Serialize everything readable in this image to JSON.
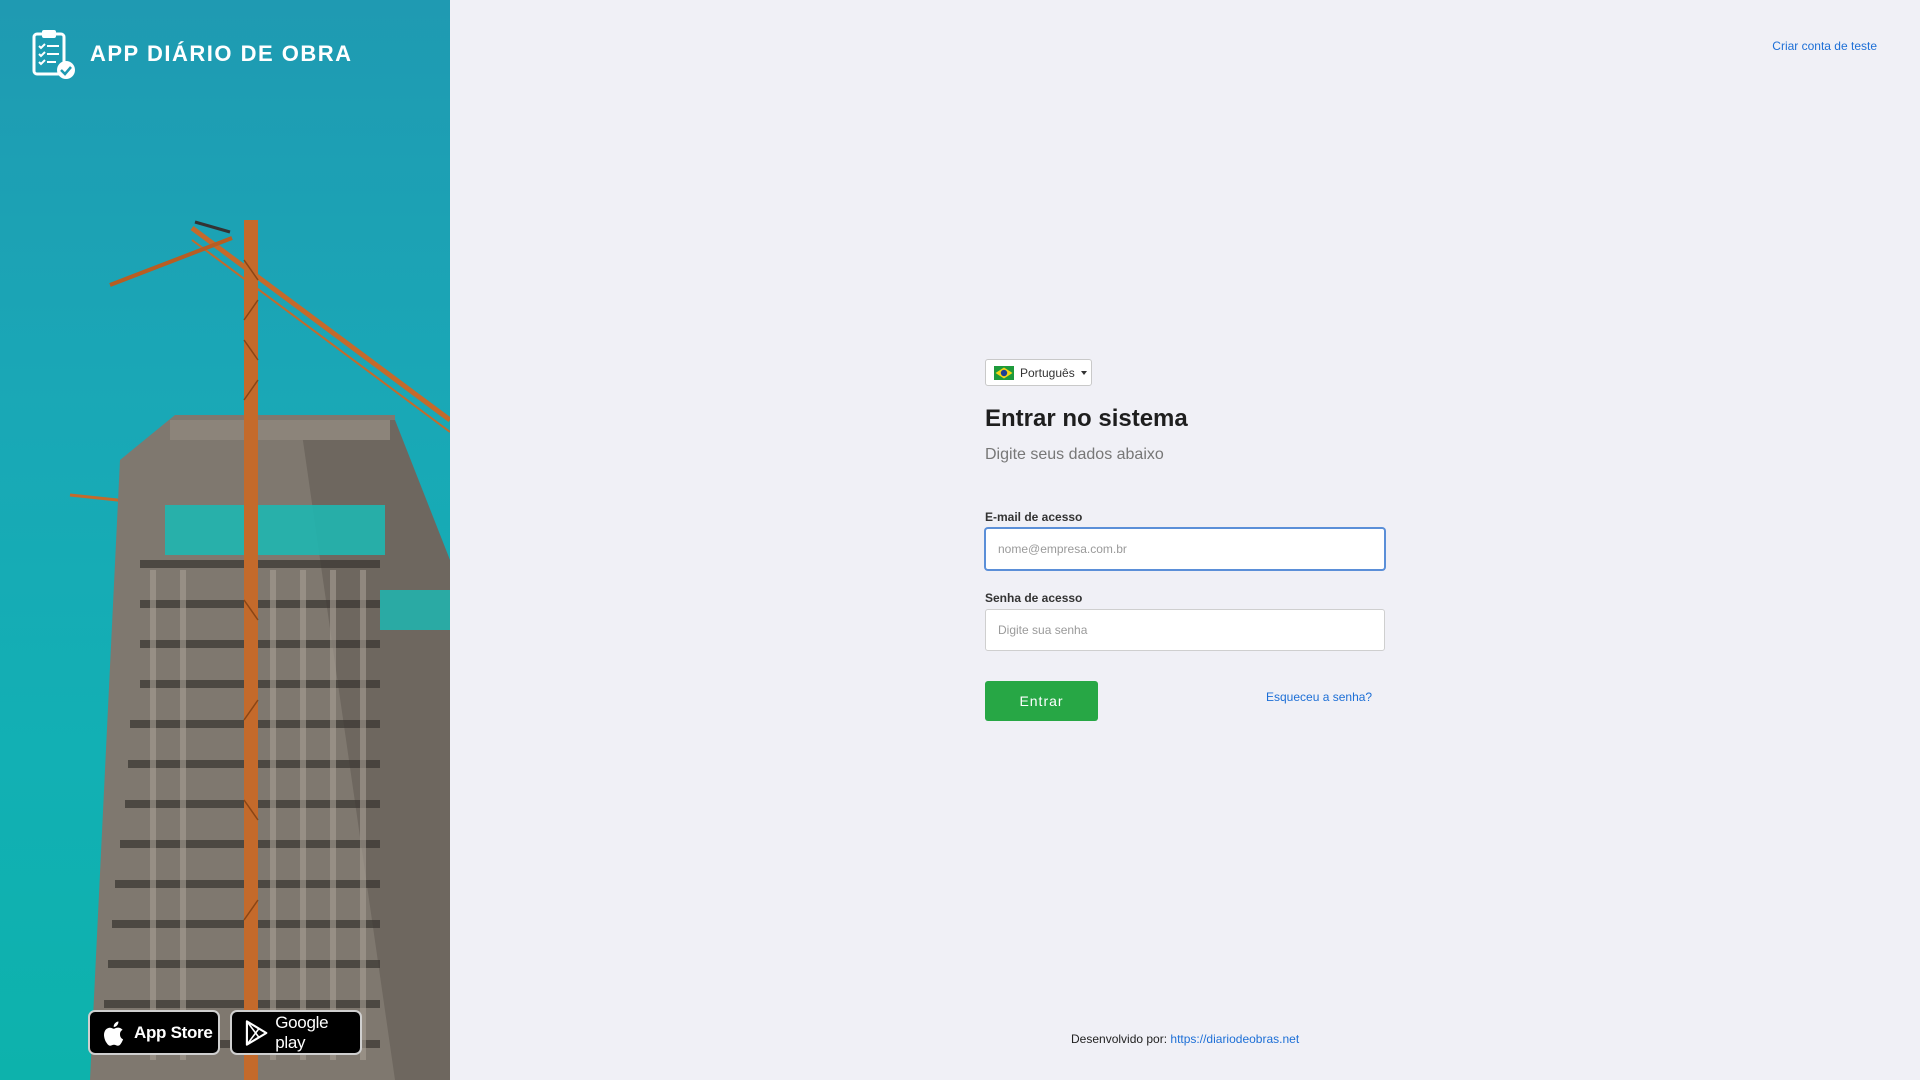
{
  "brand": {
    "title": "APP DIÁRIO DE OBRA",
    "icon": "clipboard-check-icon"
  },
  "stores": {
    "apple_label": "App Store",
    "google_label": "Google play"
  },
  "header": {
    "create_account": "Criar conta de teste"
  },
  "language": {
    "selected": "Português",
    "flag": "brazil-flag-icon"
  },
  "login": {
    "title": "Entrar no sistema",
    "subtitle": "Digite seus dados abaixo",
    "email_label": "E-mail de acesso",
    "email_placeholder": "nome@empresa.com.br",
    "email_value": "",
    "password_label": "Senha de acesso",
    "password_placeholder": "Digite sua senha",
    "submit_label": "Entrar",
    "forgot_label": "Esqueceu a senha?"
  },
  "footer": {
    "developed_by": "Desenvolvido por:",
    "link": "https://diariodeobras.net"
  },
  "colors": {
    "panel_teal": "#1aa7b6",
    "primary_green": "#27a745",
    "link_blue": "#1d6fd6",
    "background": "#f0f0f6"
  }
}
